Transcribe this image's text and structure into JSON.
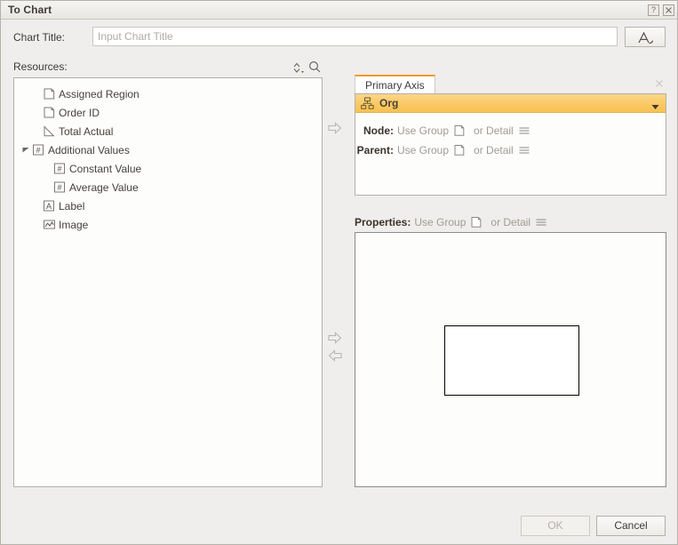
{
  "window": {
    "title": "To Chart",
    "help_icon": "help-question-icon",
    "close_icon": "close-x-icon"
  },
  "chart_title": {
    "label": "Chart Title:",
    "value": "",
    "placeholder": "Input Chart Title",
    "font_button_icon": "font-style-a-icon"
  },
  "resources": {
    "label": "Resources:",
    "sort_icon": "sort-updown-icon",
    "search_icon": "search-magnifier-icon",
    "tree": [
      {
        "label": "Assigned Region",
        "icon": "document-icon",
        "depth": 1,
        "expander": "none"
      },
      {
        "label": "Order ID",
        "icon": "document-icon",
        "depth": 1,
        "expander": "none"
      },
      {
        "label": "Total Actual",
        "icon": "trendline-icon",
        "depth": 1,
        "expander": "none"
      },
      {
        "label": "Additional Values",
        "icon": "number-icon",
        "depth": 0,
        "expander": "expanded"
      },
      {
        "label": "Constant Value",
        "icon": "number-icon",
        "depth": 2,
        "expander": "none"
      },
      {
        "label": "Average Value",
        "icon": "number-icon",
        "depth": 2,
        "expander": "none"
      },
      {
        "label": "Label",
        "icon": "text-a-icon",
        "depth": 1,
        "expander": "none"
      },
      {
        "label": "Image",
        "icon": "linechart-icon",
        "depth": 1,
        "expander": "none"
      }
    ]
  },
  "transfer": {
    "add_axis_icon": "arrow-right-icon",
    "add_prop_icon": "arrow-right-icon",
    "remove_prop_icon": "arrow-left-icon"
  },
  "axis": {
    "tab_label": "Primary Axis",
    "tab_close_icon": "close-x-icon",
    "accent_color": "#f59b1c",
    "header": {
      "label": "Org",
      "icon": "org-hierarchy-icon",
      "caret_icon": "chevron-down-icon",
      "background_color": "#fac964"
    },
    "fields": [
      {
        "key": "Node:",
        "use_group_text": "Use Group",
        "group_icon": "document-icon",
        "or_detail_text": "or Detail",
        "detail_icon": "list-lines-icon"
      },
      {
        "key": "Parent:",
        "use_group_text": "Use Group",
        "group_icon": "document-icon",
        "or_detail_text": "or Detail",
        "detail_icon": "list-lines-icon"
      }
    ]
  },
  "properties": {
    "key": "Properties:",
    "use_group_text": "Use Group",
    "group_icon": "document-icon",
    "or_detail_text": "or Detail",
    "detail_icon": "list-lines-icon",
    "drop_placeholder": ""
  },
  "footer": {
    "ok_label": "OK",
    "ok_enabled": false,
    "cancel_label": "Cancel",
    "cancel_enabled": true
  }
}
